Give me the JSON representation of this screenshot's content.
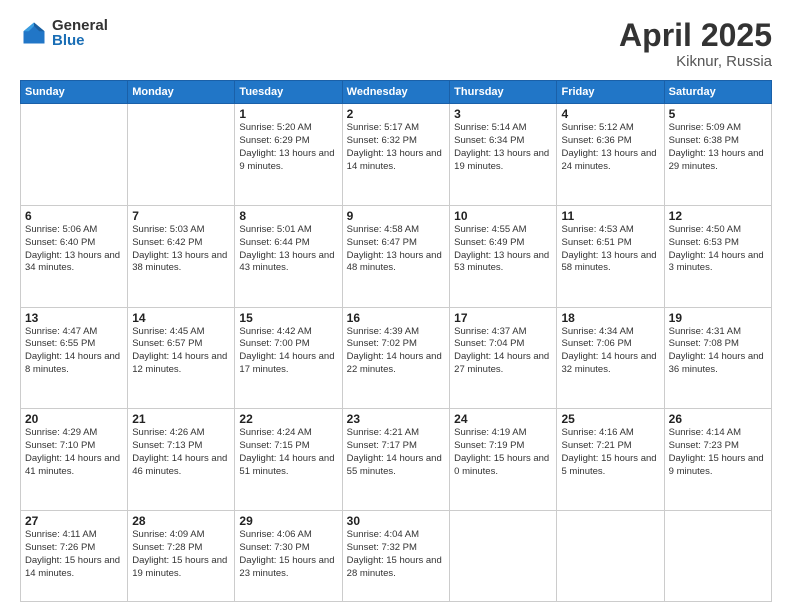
{
  "logo": {
    "general": "General",
    "blue": "Blue"
  },
  "title": {
    "month": "April 2025",
    "location": "Kiknur, Russia"
  },
  "weekdays": [
    "Sunday",
    "Monday",
    "Tuesday",
    "Wednesday",
    "Thursday",
    "Friday",
    "Saturday"
  ],
  "weeks": [
    [
      {
        "day": "",
        "info": ""
      },
      {
        "day": "",
        "info": ""
      },
      {
        "day": "1",
        "info": "Sunrise: 5:20 AM\nSunset: 6:29 PM\nDaylight: 13 hours and 9 minutes."
      },
      {
        "day": "2",
        "info": "Sunrise: 5:17 AM\nSunset: 6:32 PM\nDaylight: 13 hours and 14 minutes."
      },
      {
        "day": "3",
        "info": "Sunrise: 5:14 AM\nSunset: 6:34 PM\nDaylight: 13 hours and 19 minutes."
      },
      {
        "day": "4",
        "info": "Sunrise: 5:12 AM\nSunset: 6:36 PM\nDaylight: 13 hours and 24 minutes."
      },
      {
        "day": "5",
        "info": "Sunrise: 5:09 AM\nSunset: 6:38 PM\nDaylight: 13 hours and 29 minutes."
      }
    ],
    [
      {
        "day": "6",
        "info": "Sunrise: 5:06 AM\nSunset: 6:40 PM\nDaylight: 13 hours and 34 minutes."
      },
      {
        "day": "7",
        "info": "Sunrise: 5:03 AM\nSunset: 6:42 PM\nDaylight: 13 hours and 38 minutes."
      },
      {
        "day": "8",
        "info": "Sunrise: 5:01 AM\nSunset: 6:44 PM\nDaylight: 13 hours and 43 minutes."
      },
      {
        "day": "9",
        "info": "Sunrise: 4:58 AM\nSunset: 6:47 PM\nDaylight: 13 hours and 48 minutes."
      },
      {
        "day": "10",
        "info": "Sunrise: 4:55 AM\nSunset: 6:49 PM\nDaylight: 13 hours and 53 minutes."
      },
      {
        "day": "11",
        "info": "Sunrise: 4:53 AM\nSunset: 6:51 PM\nDaylight: 13 hours and 58 minutes."
      },
      {
        "day": "12",
        "info": "Sunrise: 4:50 AM\nSunset: 6:53 PM\nDaylight: 14 hours and 3 minutes."
      }
    ],
    [
      {
        "day": "13",
        "info": "Sunrise: 4:47 AM\nSunset: 6:55 PM\nDaylight: 14 hours and 8 minutes."
      },
      {
        "day": "14",
        "info": "Sunrise: 4:45 AM\nSunset: 6:57 PM\nDaylight: 14 hours and 12 minutes."
      },
      {
        "day": "15",
        "info": "Sunrise: 4:42 AM\nSunset: 7:00 PM\nDaylight: 14 hours and 17 minutes."
      },
      {
        "day": "16",
        "info": "Sunrise: 4:39 AM\nSunset: 7:02 PM\nDaylight: 14 hours and 22 minutes."
      },
      {
        "day": "17",
        "info": "Sunrise: 4:37 AM\nSunset: 7:04 PM\nDaylight: 14 hours and 27 minutes."
      },
      {
        "day": "18",
        "info": "Sunrise: 4:34 AM\nSunset: 7:06 PM\nDaylight: 14 hours and 32 minutes."
      },
      {
        "day": "19",
        "info": "Sunrise: 4:31 AM\nSunset: 7:08 PM\nDaylight: 14 hours and 36 minutes."
      }
    ],
    [
      {
        "day": "20",
        "info": "Sunrise: 4:29 AM\nSunset: 7:10 PM\nDaylight: 14 hours and 41 minutes."
      },
      {
        "day": "21",
        "info": "Sunrise: 4:26 AM\nSunset: 7:13 PM\nDaylight: 14 hours and 46 minutes."
      },
      {
        "day": "22",
        "info": "Sunrise: 4:24 AM\nSunset: 7:15 PM\nDaylight: 14 hours and 51 minutes."
      },
      {
        "day": "23",
        "info": "Sunrise: 4:21 AM\nSunset: 7:17 PM\nDaylight: 14 hours and 55 minutes."
      },
      {
        "day": "24",
        "info": "Sunrise: 4:19 AM\nSunset: 7:19 PM\nDaylight: 15 hours and 0 minutes."
      },
      {
        "day": "25",
        "info": "Sunrise: 4:16 AM\nSunset: 7:21 PM\nDaylight: 15 hours and 5 minutes."
      },
      {
        "day": "26",
        "info": "Sunrise: 4:14 AM\nSunset: 7:23 PM\nDaylight: 15 hours and 9 minutes."
      }
    ],
    [
      {
        "day": "27",
        "info": "Sunrise: 4:11 AM\nSunset: 7:26 PM\nDaylight: 15 hours and 14 minutes."
      },
      {
        "day": "28",
        "info": "Sunrise: 4:09 AM\nSunset: 7:28 PM\nDaylight: 15 hours and 19 minutes."
      },
      {
        "day": "29",
        "info": "Sunrise: 4:06 AM\nSunset: 7:30 PM\nDaylight: 15 hours and 23 minutes."
      },
      {
        "day": "30",
        "info": "Sunrise: 4:04 AM\nSunset: 7:32 PM\nDaylight: 15 hours and 28 minutes."
      },
      {
        "day": "",
        "info": ""
      },
      {
        "day": "",
        "info": ""
      },
      {
        "day": "",
        "info": ""
      }
    ]
  ]
}
